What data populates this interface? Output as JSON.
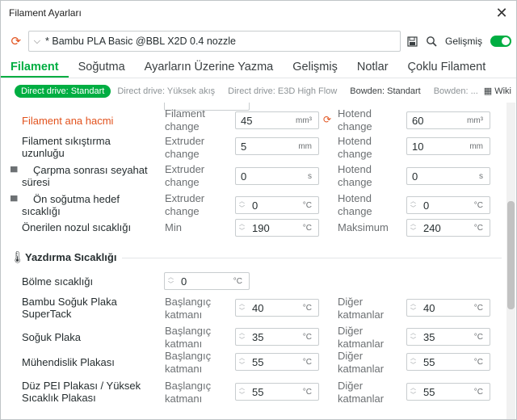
{
  "window": {
    "title": "Filament Ayarları",
    "close_glyph": "✕"
  },
  "preset": {
    "name": "* Bambu PLA Basic @BBL X2D 0.4 nozzle",
    "advanced_label": "Gelişmiş",
    "advanced_on": true
  },
  "tabs": [
    "Filament",
    "Soğutma",
    "Ayarların Üzerine Yazma",
    "Gelişmiş",
    "Notlar",
    "Çoklu Filament"
  ],
  "active_tab": 0,
  "subtabs": [
    "Direct drive: Standart",
    "Direct drive: Yüksek akış",
    "Direct drive: E3D High Flow",
    "Bowden: Standart",
    "Bowden: ..."
  ],
  "wiki_label": "Wiki",
  "rows": {
    "volume": {
      "label": "Filament ana hacmi",
      "left_sub": "Filament change",
      "left_value": "45",
      "left_unit": "mm³",
      "right_sub": "Hotend change",
      "right_value": "60",
      "right_unit": "mm³"
    },
    "compression": {
      "label": "Filament sıkıştırma uzunluğu",
      "left_sub": "Extruder change",
      "left_value": "5",
      "left_unit": "mm",
      "right_sub": "Hotend change",
      "right_value": "10",
      "right_unit": "mm"
    },
    "travel": {
      "label": "Çarpma sonrası seyahat süresi",
      "left_sub": "Extruder change",
      "left_value": "0",
      "left_unit": "s",
      "right_sub": "Hotend change",
      "right_value": "0",
      "right_unit": "s"
    },
    "precool": {
      "label": "Ön soğutma hedef sıcaklığı",
      "left_sub": "Extruder change",
      "left_value": "0",
      "left_unit": "°C",
      "right_sub": "Hotend change",
      "right_value": "0",
      "right_unit": "°C"
    },
    "nozzle": {
      "label": "Önerilen nozul sıcaklığı",
      "left_sub": "Min",
      "left_value": "190",
      "left_unit": "°C",
      "right_sub": "Maksimum",
      "right_value": "240",
      "right_unit": "°C"
    }
  },
  "print_temp": {
    "title": "Yazdırma Sıcaklığı",
    "chamber": {
      "label": "Bölme sıcaklığı",
      "value": "0",
      "unit": "°C"
    },
    "plates": [
      {
        "label": "Bambu Soğuk Plaka SuperTack",
        "left_sub": "Başlangıç katmanı",
        "left_value": "40",
        "right_sub": "Diğer katmanlar",
        "right_value": "40",
        "unit": "°C"
      },
      {
        "label": "Soğuk Plaka",
        "left_sub": "Başlangıç katmanı",
        "left_value": "35",
        "right_sub": "Diğer katmanlar",
        "right_value": "35",
        "unit": "°C"
      },
      {
        "label": "Mühendislik Plakası",
        "left_sub": "Başlangıç katmanı",
        "left_value": "55",
        "right_sub": "Diğer katmanlar",
        "right_value": "55",
        "unit": "°C"
      },
      {
        "label": "Düz PEI Plakası / Yüksek Sıcaklık Plakası",
        "left_sub": "Başlangıç katmanı",
        "left_value": "55",
        "right_sub": "Diğer katmanlar",
        "right_value": "55",
        "unit": "°C"
      }
    ]
  }
}
